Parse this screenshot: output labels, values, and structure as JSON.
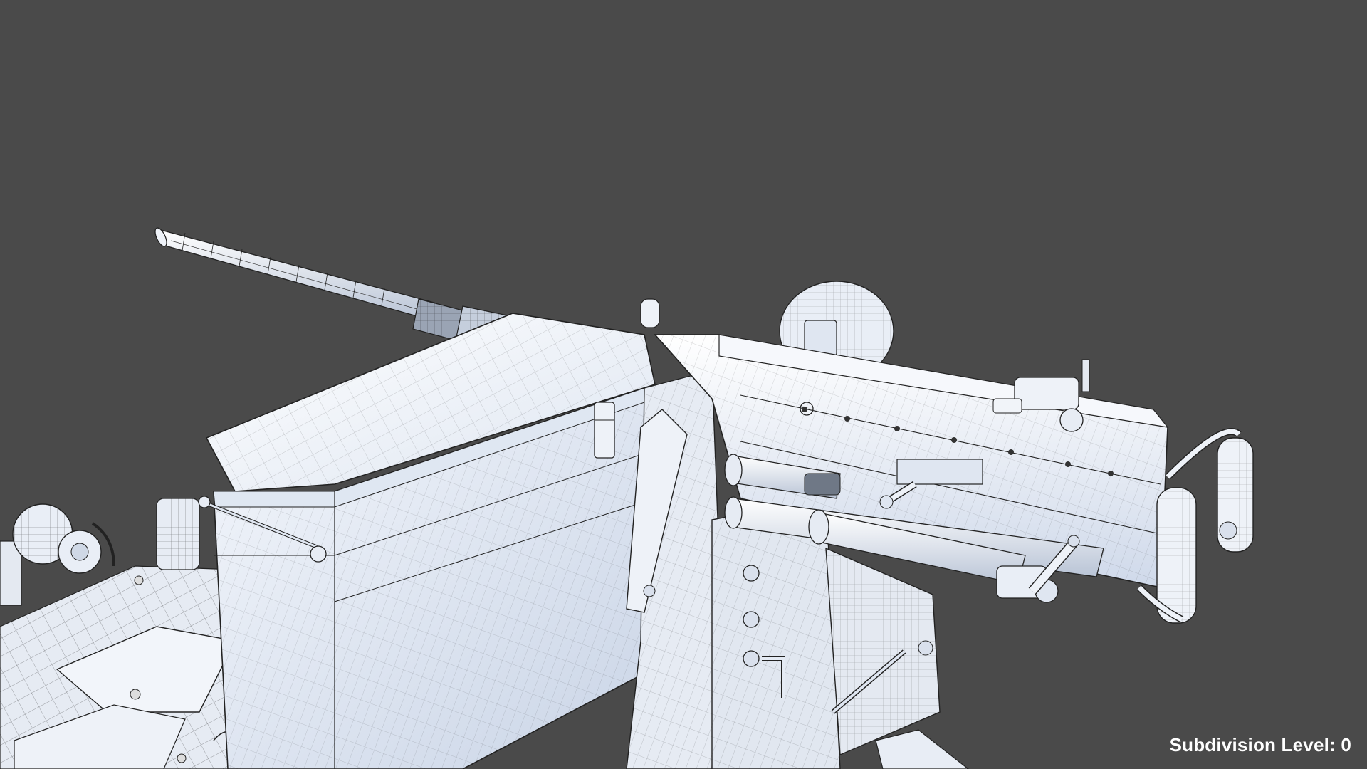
{
  "viewport": {
    "background_color": "#4a4a4a",
    "model_color": "#e8eef8",
    "wire_color": "#1e1e1e"
  },
  "overlay": {
    "subdivision_label": "Subdivision Level: 0"
  }
}
